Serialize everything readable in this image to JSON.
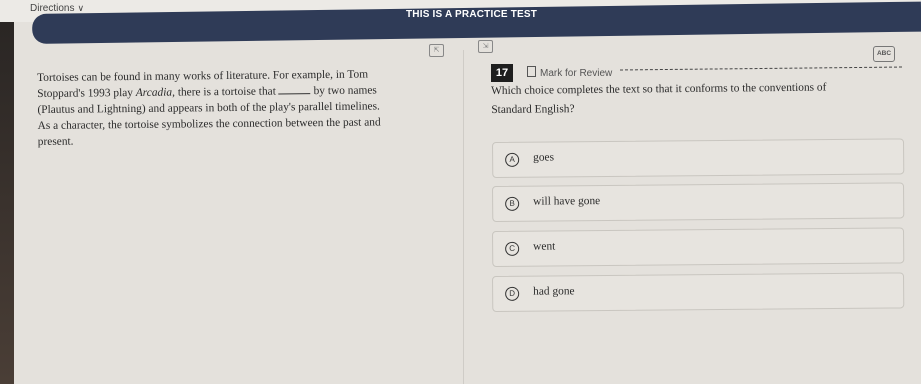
{
  "header": {
    "directions_label": "Directions",
    "banner_title": "THIS IS A PRACTICE TEST"
  },
  "passage": {
    "line1": "Tortoises can be found in many works of literature. For example, in Tom",
    "line2_before": "Stoppard's 1993 play ",
    "line2_italic": "Arcadia",
    "line2_mid": ", there is a tortoise that",
    "line2_after": " by two names",
    "line3": "(Plautus and Lightning) and appears in both of the play's parallel timelines.",
    "line4": "As a character, the tortoise symbolizes the connection between the past and",
    "line5": "present."
  },
  "question": {
    "number": "17",
    "mark_for_review": "Mark for Review",
    "abc_icon_text": "ABC",
    "line1": "Which choice completes the text so that it conforms to the conventions of",
    "line2": "Standard English?"
  },
  "choices": [
    {
      "letter": "A",
      "text": "goes"
    },
    {
      "letter": "B",
      "text": "will have gone"
    },
    {
      "letter": "C",
      "text": "went"
    },
    {
      "letter": "D",
      "text": "had gone"
    }
  ]
}
